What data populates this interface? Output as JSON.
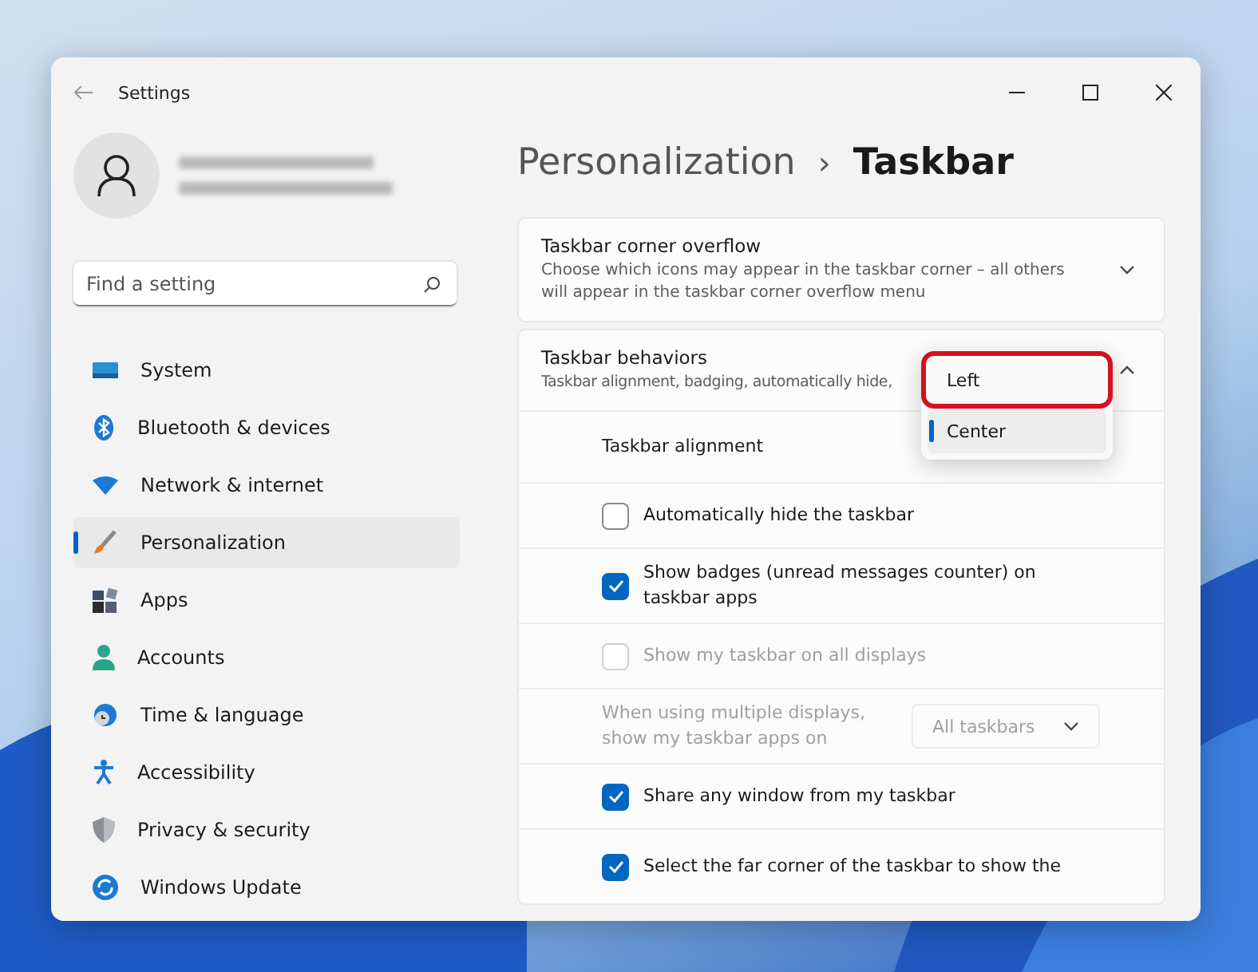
{
  "window": {
    "title": "Settings"
  },
  "search": {
    "placeholder": "Find a setting"
  },
  "nav": [
    {
      "label": "System",
      "selected": false
    },
    {
      "label": "Bluetooth & devices",
      "selected": false
    },
    {
      "label": "Network & internet",
      "selected": false
    },
    {
      "label": "Personalization",
      "selected": true
    },
    {
      "label": "Apps",
      "selected": false
    },
    {
      "label": "Accounts",
      "selected": false
    },
    {
      "label": "Time & language",
      "selected": false
    },
    {
      "label": "Accessibility",
      "selected": false
    },
    {
      "label": "Privacy & security",
      "selected": false
    },
    {
      "label": "Windows Update",
      "selected": false
    }
  ],
  "breadcrumb": {
    "parent": "Personalization",
    "separator": "›",
    "current": "Taskbar"
  },
  "sections": [
    {
      "title": "Taskbar corner overflow",
      "description": "Choose which icons may appear in the taskbar corner – all others will appear in the taskbar corner overflow menu",
      "expanded": false
    },
    {
      "title": "Taskbar behaviors",
      "description": "Taskbar alignment, badging, automatically hide,",
      "expanded": true,
      "rows": [
        {
          "kind": "menu",
          "label": "Taskbar alignment",
          "options": [
            {
              "label": "Left",
              "selected": false,
              "highlighted": true
            },
            {
              "label": "Center",
              "selected": true,
              "highlighted": false
            }
          ]
        },
        {
          "kind": "checkbox",
          "label": "Automatically hide the taskbar",
          "checked": false,
          "disabled": false
        },
        {
          "kind": "checkbox",
          "label": "Show badges (unread messages counter) on taskbar apps",
          "checked": true,
          "disabled": false
        },
        {
          "kind": "checkbox",
          "label": "Show my taskbar on all displays",
          "checked": false,
          "disabled": true
        },
        {
          "kind": "select",
          "label": "When using multiple displays, show my taskbar apps on",
          "value": "All taskbars",
          "disabled": true
        },
        {
          "kind": "checkbox",
          "label": "Share any window from my taskbar",
          "checked": true,
          "disabled": false
        },
        {
          "kind": "checkbox",
          "label": "Select the far corner of the taskbar to show the",
          "checked": true,
          "disabled": false
        }
      ]
    }
  ]
}
